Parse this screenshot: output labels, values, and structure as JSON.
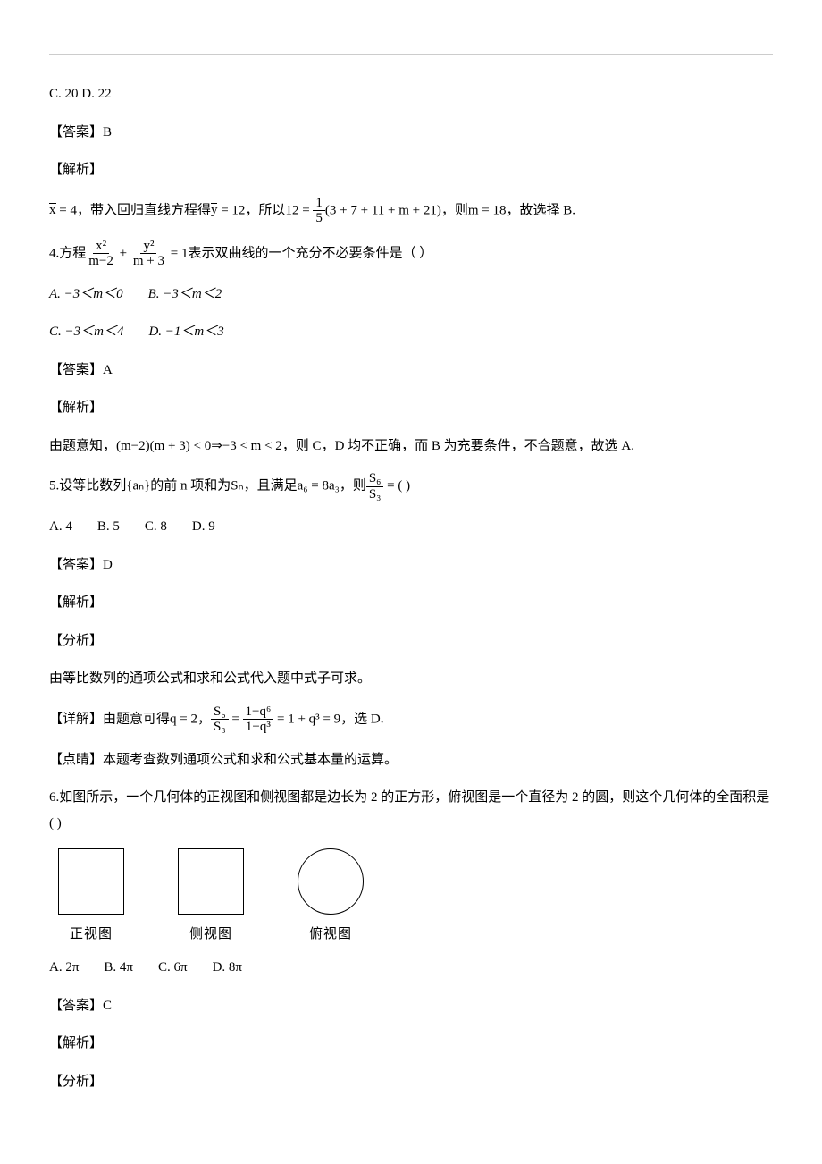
{
  "q3": {
    "options_line1": "C. 20     D. 22",
    "answer_label": "【答案】",
    "answer_value": "B",
    "explain_label": "【解析】",
    "sol_pre": "x",
    "sol_eq1": " = 4，带入回归直线方程得",
    "sol_ybar": "y",
    "sol_eq2": " = 12，所以",
    "sol_eq3": "12 = ",
    "sol_frac_num": "1",
    "sol_frac_den": "5",
    "sol_after": "(3 + 7 + 11 + m + 21)，则m = 18，故选择 B."
  },
  "q4": {
    "stem_pre": "4.方程",
    "frac1_num": "x²",
    "frac1_den": "m−2",
    "plus": " + ",
    "frac2_num": "y²",
    "frac2_den": "m + 3",
    "eq_tail": " = 1表示双曲线的一个充分不必要条件是（    ）",
    "optA": "A.  −3＜m＜0",
    "optB": "B.  −3＜m＜2",
    "optC": "C.  −3＜m＜4",
    "optD": "D.  −1＜m＜3",
    "answer_label": "【答案】",
    "answer_value": "A",
    "explain_label": "【解析】",
    "sol": "由题意知，(m−2)(m + 3) < 0⇒−3 < m < 2，则 C，D 均不正确，而 B 为充要条件，不合题意，故选 A."
  },
  "q5": {
    "stem_pre": "5.设等比数列{aₙ}的前 n 项和为Sₙ，且满足a₆ = 8a₃，则",
    "ratio_num": "S₆",
    "ratio_den": "S₃",
    "stem_mid": " = (        )",
    "optA": "A.  4",
    "optB": "B.  5",
    "optC": "C.  8",
    "optD": "D.  9",
    "answer_label": "【答案】",
    "answer_value": "D",
    "explain_label": "【解析】",
    "analysis_label": "【分析】",
    "analysis": "由等比数列的通项公式和求和公式代入题中式子可求。",
    "detail_label": "【详解】",
    "detail_pre": "由题意可得q = 2，",
    "frac_a_num": "S₆",
    "frac_a_den": "S₃",
    "eq": " = ",
    "frac_b_num": "1−q⁶",
    "frac_b_den": "1−q³",
    "detail_post": " = 1 + q³ = 9，选 D.",
    "comment_label": "【点睛】",
    "comment": "本题考查数列通项公式和求和公式基本量的运算。"
  },
  "q6": {
    "stem": "6.如图所示，一个几何体的正视图和侧视图都是边长为 2 的正方形，俯视图是一个直径为 2 的圆，则这个几何体的全面积是(        )",
    "view1": "正视图",
    "view2": "侧视图",
    "view3": "俯视图",
    "optA": "A.  2π",
    "optB": "B.  4π",
    "optC": "C.  6π",
    "optD": "D.  8π",
    "answer_label": "【答案】",
    "answer_value": "C",
    "explain_label": "【解析】",
    "analysis_label": "【分析】"
  }
}
